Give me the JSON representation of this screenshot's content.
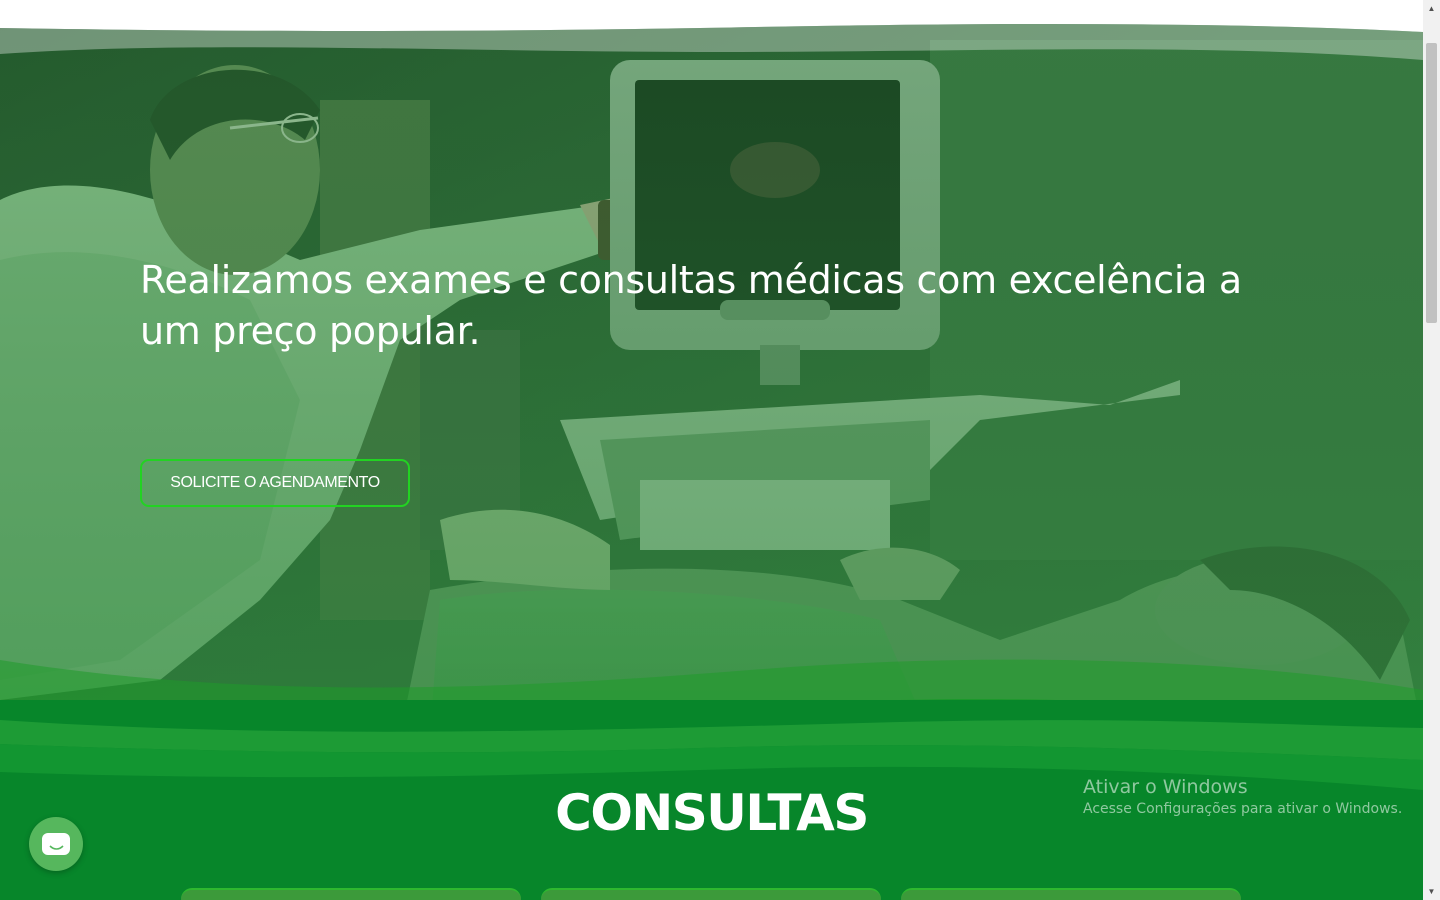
{
  "hero": {
    "title": "Realizamos exames e consultas médicas com excelência a um preço popular.",
    "cta_label": "SOLICITE O AGENDAMENTO",
    "image_subject": "ultrasound-exam-photo",
    "overlay_color": "#2e8b3e"
  },
  "consultas": {
    "heading": "CONSULTAS",
    "background_color": "#0a8a2a"
  },
  "watermark": {
    "title": "Ativar o Windows",
    "subtitle": "Acesse Configurações para ativar o Windows."
  },
  "chat": {
    "icon": "chat-bubble-icon"
  },
  "colors": {
    "accent_green": "#22d322",
    "dark_green": "#078a2a"
  }
}
